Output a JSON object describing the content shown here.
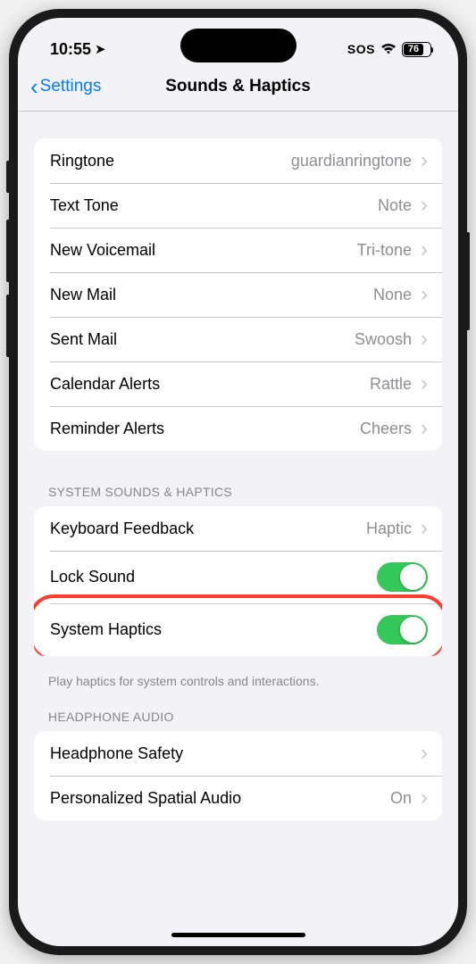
{
  "status": {
    "time": "10:55",
    "sos": "SOS",
    "battery": "76"
  },
  "nav": {
    "back": "Settings",
    "title": "Sounds & Haptics"
  },
  "sounds": [
    {
      "label": "Ringtone",
      "value": "guardianringtone"
    },
    {
      "label": "Text Tone",
      "value": "Note"
    },
    {
      "label": "New Voicemail",
      "value": "Tri-tone"
    },
    {
      "label": "New Mail",
      "value": "None"
    },
    {
      "label": "Sent Mail",
      "value": "Swoosh"
    },
    {
      "label": "Calendar Alerts",
      "value": "Rattle"
    },
    {
      "label": "Reminder Alerts",
      "value": "Cheers"
    }
  ],
  "section2": {
    "header": "System Sounds & Haptics",
    "keyboard": {
      "label": "Keyboard Feedback",
      "value": "Haptic"
    },
    "lock": {
      "label": "Lock Sound"
    },
    "haptics": {
      "label": "System Haptics"
    },
    "footer": "Play haptics for system controls and interactions."
  },
  "section3": {
    "header": "Headphone Audio",
    "safety": {
      "label": "Headphone Safety"
    },
    "spatial": {
      "label": "Personalized Spatial Audio",
      "value": "On"
    }
  }
}
